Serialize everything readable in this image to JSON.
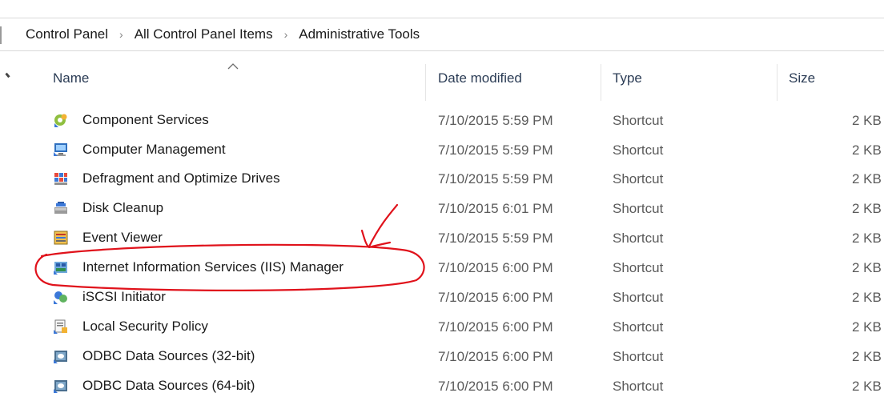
{
  "breadcrumb": {
    "items": [
      "Control Panel",
      "All Control Panel Items",
      "Administrative Tools"
    ],
    "separator": "›"
  },
  "columns": {
    "name": "Name",
    "date": "Date modified",
    "type": "Type",
    "size": "Size"
  },
  "rows": [
    {
      "name": "Component Services",
      "date": "7/10/2015 5:59 PM",
      "type": "Shortcut",
      "size": "2 KB",
      "icon": "component-services-icon"
    },
    {
      "name": "Computer Management",
      "date": "7/10/2015 5:59 PM",
      "type": "Shortcut",
      "size": "2 KB",
      "icon": "computer-management-icon"
    },
    {
      "name": "Defragment and Optimize Drives",
      "date": "7/10/2015 5:59 PM",
      "type": "Shortcut",
      "size": "2 KB",
      "icon": "defragment-icon"
    },
    {
      "name": "Disk Cleanup",
      "date": "7/10/2015 6:01 PM",
      "type": "Shortcut",
      "size": "2 KB",
      "icon": "disk-cleanup-icon"
    },
    {
      "name": "Event Viewer",
      "date": "7/10/2015 5:59 PM",
      "type": "Shortcut",
      "size": "2 KB",
      "icon": "event-viewer-icon"
    },
    {
      "name": "Internet Information Services (IIS) Manager",
      "date": "7/10/2015 6:00 PM",
      "type": "Shortcut",
      "size": "2 KB",
      "icon": "iis-manager-icon"
    },
    {
      "name": "iSCSI Initiator",
      "date": "7/10/2015 6:00 PM",
      "type": "Shortcut",
      "size": "2 KB",
      "icon": "iscsi-initiator-icon"
    },
    {
      "name": "Local Security Policy",
      "date": "7/10/2015 6:00 PM",
      "type": "Shortcut",
      "size": "2 KB",
      "icon": "local-security-policy-icon"
    },
    {
      "name": "ODBC Data Sources (32-bit)",
      "date": "7/10/2015 6:00 PM",
      "type": "Shortcut",
      "size": "2 KB",
      "icon": "odbc-icon"
    },
    {
      "name": "ODBC Data Sources (64-bit)",
      "date": "7/10/2015 6:00 PM",
      "type": "Shortcut",
      "size": "2 KB",
      "icon": "odbc-icon"
    }
  ],
  "colors": {
    "header_text": "#2b3c55",
    "annotation": "#e0121b",
    "secondary_text": "#5a5a5a"
  }
}
